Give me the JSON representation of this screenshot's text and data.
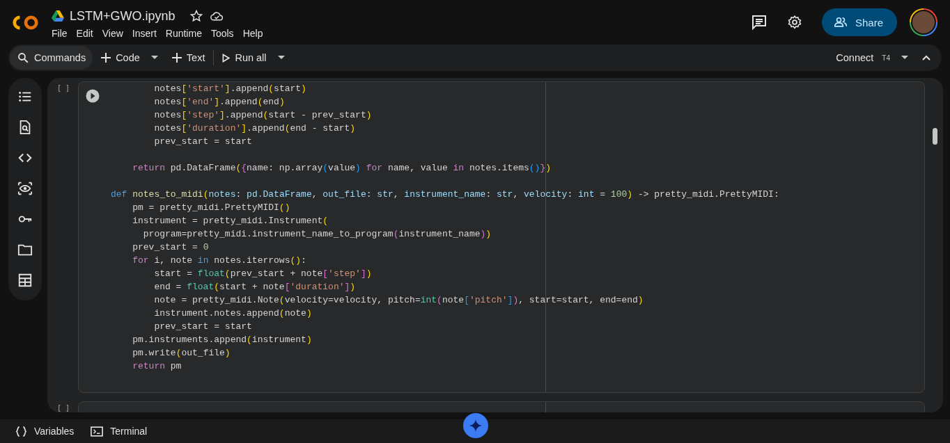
{
  "header": {
    "title": "LSTM+GWO.ipynb",
    "menu": [
      "File",
      "Edit",
      "View",
      "Insert",
      "Runtime",
      "Tools",
      "Help"
    ],
    "share": "Share"
  },
  "toolbar": {
    "commands": "Commands",
    "add_code": "Code",
    "add_text": "Text",
    "run_all": "Run all",
    "connect": "Connect",
    "runtime_type": "T4"
  },
  "cells": [
    {
      "marker": "[ ]",
      "lines": [
        {
          "t": [
            {
              "kind": "p",
              "text": "        notes"
            },
            {
              "kind": "y",
              "text": "["
            },
            {
              "kind": "s",
              "text": "'start'"
            },
            {
              "kind": "y",
              "text": "]"
            },
            {
              "kind": "p",
              "text": ".append"
            },
            {
              "kind": "y",
              "text": "("
            },
            {
              "kind": "p",
              "text": "start"
            },
            {
              "kind": "y",
              "text": ")"
            }
          ]
        },
        {
          "t": [
            {
              "kind": "p",
              "text": "        notes"
            },
            {
              "kind": "y",
              "text": "["
            },
            {
              "kind": "s",
              "text": "'end'"
            },
            {
              "kind": "y",
              "text": "]"
            },
            {
              "kind": "p",
              "text": ".append"
            },
            {
              "kind": "y",
              "text": "("
            },
            {
              "kind": "p",
              "text": "end"
            },
            {
              "kind": "y",
              "text": ")"
            }
          ]
        },
        {
          "t": [
            {
              "kind": "p",
              "text": "        notes"
            },
            {
              "kind": "y",
              "text": "["
            },
            {
              "kind": "s",
              "text": "'step'"
            },
            {
              "kind": "y",
              "text": "]"
            },
            {
              "kind": "p",
              "text": ".append"
            },
            {
              "kind": "y",
              "text": "("
            },
            {
              "kind": "p",
              "text": "start - prev_start"
            },
            {
              "kind": "y",
              "text": ")"
            }
          ]
        },
        {
          "t": [
            {
              "kind": "p",
              "text": "        notes"
            },
            {
              "kind": "y",
              "text": "["
            },
            {
              "kind": "s",
              "text": "'duration'"
            },
            {
              "kind": "y",
              "text": "]"
            },
            {
              "kind": "p",
              "text": ".append"
            },
            {
              "kind": "y",
              "text": "("
            },
            {
              "kind": "p",
              "text": "end - start"
            },
            {
              "kind": "y",
              "text": ")"
            }
          ]
        },
        {
          "t": [
            {
              "kind": "p",
              "text": "        prev_start = start"
            }
          ],
          "blank_after": true
        },
        {
          "t": [
            {
              "kind": "k",
              "text": "    return"
            },
            {
              "kind": "p",
              "text": " pd.DataFrame"
            },
            {
              "kind": "y",
              "text": "("
            },
            {
              "kind": "m",
              "text": "{"
            },
            {
              "kind": "p",
              "text": "name: np.array"
            },
            {
              "kind": "b",
              "text": "("
            },
            {
              "kind": "p",
              "text": "value"
            },
            {
              "kind": "b",
              "text": ")"
            },
            {
              "kind": "k",
              "text": " for"
            },
            {
              "kind": "p",
              "text": " name, value "
            },
            {
              "kind": "k",
              "text": "in"
            },
            {
              "kind": "p",
              "text": " notes.items"
            },
            {
              "kind": "b",
              "text": "()"
            },
            {
              "kind": "m",
              "text": "}"
            },
            {
              "kind": "y",
              "text": ")"
            }
          ],
          "blank_after": true
        },
        {
          "t": [
            {
              "kind": "d",
              "text": "def "
            },
            {
              "kind": "f",
              "text": "notes_to_midi"
            },
            {
              "kind": "y",
              "text": "("
            },
            {
              "kind": "a",
              "text": "notes"
            },
            {
              "kind": "p",
              "text": ": "
            },
            {
              "kind": "a",
              "text": "pd.DataFrame"
            },
            {
              "kind": "p",
              "text": ", "
            },
            {
              "kind": "a",
              "text": "out_file"
            },
            {
              "kind": "p",
              "text": ": "
            },
            {
              "kind": "a",
              "text": "str"
            },
            {
              "kind": "p",
              "text": ", "
            },
            {
              "kind": "a",
              "text": "instrument_name"
            },
            {
              "kind": "p",
              "text": ": "
            },
            {
              "kind": "a",
              "text": "str"
            },
            {
              "kind": "p",
              "text": ", "
            },
            {
              "kind": "a",
              "text": "velocity"
            },
            {
              "kind": "p",
              "text": ": "
            },
            {
              "kind": "a",
              "text": "int"
            },
            {
              "kind": "p",
              "text": " = "
            },
            {
              "kind": "n",
              "text": "100"
            },
            {
              "kind": "y",
              "text": ")"
            },
            {
              "kind": "p",
              "text": " -> pretty_midi.PrettyMIDI:"
            }
          ]
        },
        {
          "t": [
            {
              "kind": "p",
              "text": "    pm = pretty_midi.PrettyMIDI"
            },
            {
              "kind": "y",
              "text": "()"
            }
          ]
        },
        {
          "t": [
            {
              "kind": "p",
              "text": "    instrument = pretty_midi.Instrument"
            },
            {
              "kind": "y",
              "text": "("
            }
          ]
        },
        {
          "t": [
            {
              "kind": "p",
              "text": "      program=pretty_midi.instrument_name_to_program"
            },
            {
              "kind": "m",
              "text": "("
            },
            {
              "kind": "p",
              "text": "instrument_name"
            },
            {
              "kind": "m",
              "text": ")"
            },
            {
              "kind": "y",
              "text": ")"
            }
          ]
        },
        {
          "t": [
            {
              "kind": "p",
              "text": "    prev_start = "
            },
            {
              "kind": "n",
              "text": "0"
            }
          ]
        },
        {
          "t": [
            {
              "kind": "k",
              "text": "    for"
            },
            {
              "kind": "p",
              "text": " i, note "
            },
            {
              "kind": "d",
              "text": "in"
            },
            {
              "kind": "p",
              "text": " notes.iterrows"
            },
            {
              "kind": "y",
              "text": "()"
            },
            {
              "kind": "p",
              "text": ":"
            }
          ]
        },
        {
          "t": [
            {
              "kind": "p",
              "text": "        start = "
            },
            {
              "kind": "t",
              "text": "float"
            },
            {
              "kind": "y",
              "text": "("
            },
            {
              "kind": "p",
              "text": "prev_start + note"
            },
            {
              "kind": "m",
              "text": "["
            },
            {
              "kind": "s",
              "text": "'step'"
            },
            {
              "kind": "m",
              "text": "]"
            },
            {
              "kind": "y",
              "text": ")"
            }
          ]
        },
        {
          "t": [
            {
              "kind": "p",
              "text": "        end = "
            },
            {
              "kind": "t",
              "text": "float"
            },
            {
              "kind": "y",
              "text": "("
            },
            {
              "kind": "p",
              "text": "start + note"
            },
            {
              "kind": "m",
              "text": "["
            },
            {
              "kind": "s",
              "text": "'duration'"
            },
            {
              "kind": "m",
              "text": "]"
            },
            {
              "kind": "y",
              "text": ")"
            }
          ]
        },
        {
          "t": [
            {
              "kind": "p",
              "text": "        note = pretty_midi.Note"
            },
            {
              "kind": "y",
              "text": "("
            },
            {
              "kind": "p",
              "text": "velocity=velocity, pitch="
            },
            {
              "kind": "t",
              "text": "int"
            },
            {
              "kind": "m",
              "text": "("
            },
            {
              "kind": "p",
              "text": "note"
            },
            {
              "kind": "b",
              "text": "["
            },
            {
              "kind": "s",
              "text": "'pitch'"
            },
            {
              "kind": "b",
              "text": "]"
            },
            {
              "kind": "m",
              "text": ")"
            },
            {
              "kind": "p",
              "text": ", start=start, end=end"
            },
            {
              "kind": "y",
              "text": ")"
            }
          ]
        },
        {
          "t": [
            {
              "kind": "p",
              "text": "        instrument.notes.append"
            },
            {
              "kind": "y",
              "text": "("
            },
            {
              "kind": "p",
              "text": "note"
            },
            {
              "kind": "y",
              "text": ")"
            }
          ]
        },
        {
          "t": [
            {
              "kind": "p",
              "text": "        prev_start = start"
            }
          ]
        },
        {
          "t": [
            {
              "kind": "p",
              "text": "    pm.instruments.append"
            },
            {
              "kind": "y",
              "text": "("
            },
            {
              "kind": "p",
              "text": "instrument"
            },
            {
              "kind": "y",
              "text": ")"
            }
          ]
        },
        {
          "t": [
            {
              "kind": "p",
              "text": "    pm.write"
            },
            {
              "kind": "y",
              "text": "("
            },
            {
              "kind": "p",
              "text": "out_file"
            },
            {
              "kind": "y",
              "text": ")"
            }
          ]
        },
        {
          "t": [
            {
              "kind": "k",
              "text": "    return"
            },
            {
              "kind": "p",
              "text": " pm"
            }
          ]
        }
      ]
    },
    {
      "marker": "[ ]"
    }
  ],
  "bottom_bar": {
    "variables": "Variables",
    "terminal": "Terminal"
  }
}
